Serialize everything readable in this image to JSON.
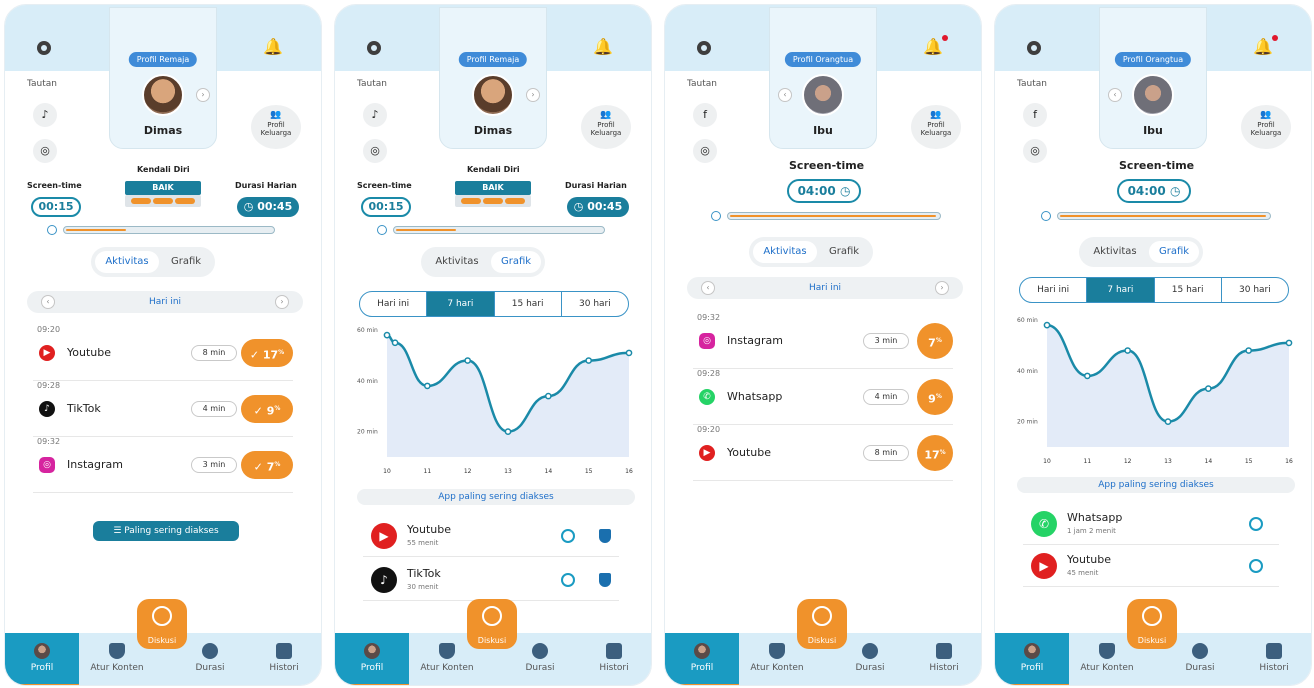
{
  "common": {
    "tautan": "Tautan",
    "family": [
      "Profil",
      "Keluarga"
    ],
    "nav": [
      "Profil",
      "Atur Konten",
      "Durasi",
      "Histori"
    ],
    "fab": "Diskusi",
    "tab_aktivitas": "Aktivitas",
    "tab_grafik": "Grafik"
  },
  "s1": {
    "tag": "Profil Remaja",
    "name": "Dimas",
    "screen_time_label": "Screen-time",
    "screen_time": "00:15",
    "kendali_label": "Kendali Diri",
    "kendali": "BAIK",
    "durasi_label": "Durasi Harian",
    "durasi": "00:45",
    "date": "Hari ini",
    "rows": [
      {
        "time": "09:20",
        "app": "Youtube",
        "min": "8 min",
        "pct": "17"
      },
      {
        "time": "09:28",
        "app": "TikTok",
        "min": "4 min",
        "pct": "9"
      },
      {
        "time": "09:32",
        "app": "Instagram",
        "min": "3 min",
        "pct": "7"
      }
    ],
    "most_btn": "Paling sering diakses",
    "pct_unit": "%"
  },
  "s2": {
    "tag": "Profil Remaja",
    "name": "Dimas",
    "screen_time_label": "Screen-time",
    "screen_time": "00:15",
    "kendali_label": "Kendali Diri",
    "kendali": "BAIK",
    "durasi_label": "Durasi Harian",
    "durasi": "00:45",
    "ranges": [
      "Hari ini",
      "7 hari",
      "15 hari",
      "30 hari"
    ],
    "apps_head": "App paling sering diakses",
    "apps": [
      {
        "name": "Youtube",
        "sub": "55 menit"
      },
      {
        "name": "TikTok",
        "sub": "30 menit"
      }
    ]
  },
  "s3": {
    "tag": "Profil Orangtua",
    "name": "Ibu",
    "screen_time_label": "Screen-time",
    "screen_time": "04:00",
    "date": "Hari ini",
    "rows": [
      {
        "time": "09:32",
        "app": "Instagram",
        "min": "3 min",
        "pct": "7"
      },
      {
        "time": "09:28",
        "app": "Whatsapp",
        "min": "4 min",
        "pct": "9"
      },
      {
        "time": "09:20",
        "app": "Youtube",
        "min": "8 min",
        "pct": "17"
      }
    ],
    "pct_unit": "%"
  },
  "s4": {
    "tag": "Profil Orangtua",
    "name": "Ibu",
    "screen_time_label": "Screen-time",
    "screen_time": "04:00",
    "ranges": [
      "Hari ini",
      "7 hari",
      "15 hari",
      "30 hari"
    ],
    "apps_head": "App paling sering diakses",
    "apps": [
      {
        "name": "Whatsapp",
        "sub": "1 jam 2 menit"
      },
      {
        "name": "Youtube",
        "sub": "45 menit"
      }
    ]
  },
  "chart_data": [
    {
      "type": "line",
      "x": [
        10,
        11,
        12,
        13,
        14,
        15,
        16
      ],
      "y_ticks": [
        "20 min",
        "40 min",
        "60 min"
      ],
      "points": [
        [
          10,
          58
        ],
        [
          10.2,
          55
        ],
        [
          11,
          38
        ],
        [
          12,
          48
        ],
        [
          13,
          20
        ],
        [
          14,
          34
        ],
        [
          15,
          48
        ],
        [
          16,
          51
        ]
      ],
      "xlim": [
        10,
        16
      ],
      "ylim": [
        10,
        62
      ],
      "colors": {
        "line": "#1a8aa8",
        "fill": "#e3ebf8"
      }
    },
    {
      "type": "line",
      "x": [
        10,
        11,
        12,
        13,
        14,
        15,
        16
      ],
      "y_ticks": [
        "20 min",
        "40 min",
        "60 min"
      ],
      "points": [
        [
          10,
          58
        ],
        [
          11,
          38
        ],
        [
          12,
          48
        ],
        [
          13,
          20
        ],
        [
          14,
          33
        ],
        [
          15,
          48
        ],
        [
          16,
          51
        ]
      ],
      "xlim": [
        10,
        16
      ],
      "ylim": [
        10,
        62
      ],
      "colors": {
        "line": "#1a8aa8",
        "fill": "#e3ebf8"
      }
    }
  ]
}
